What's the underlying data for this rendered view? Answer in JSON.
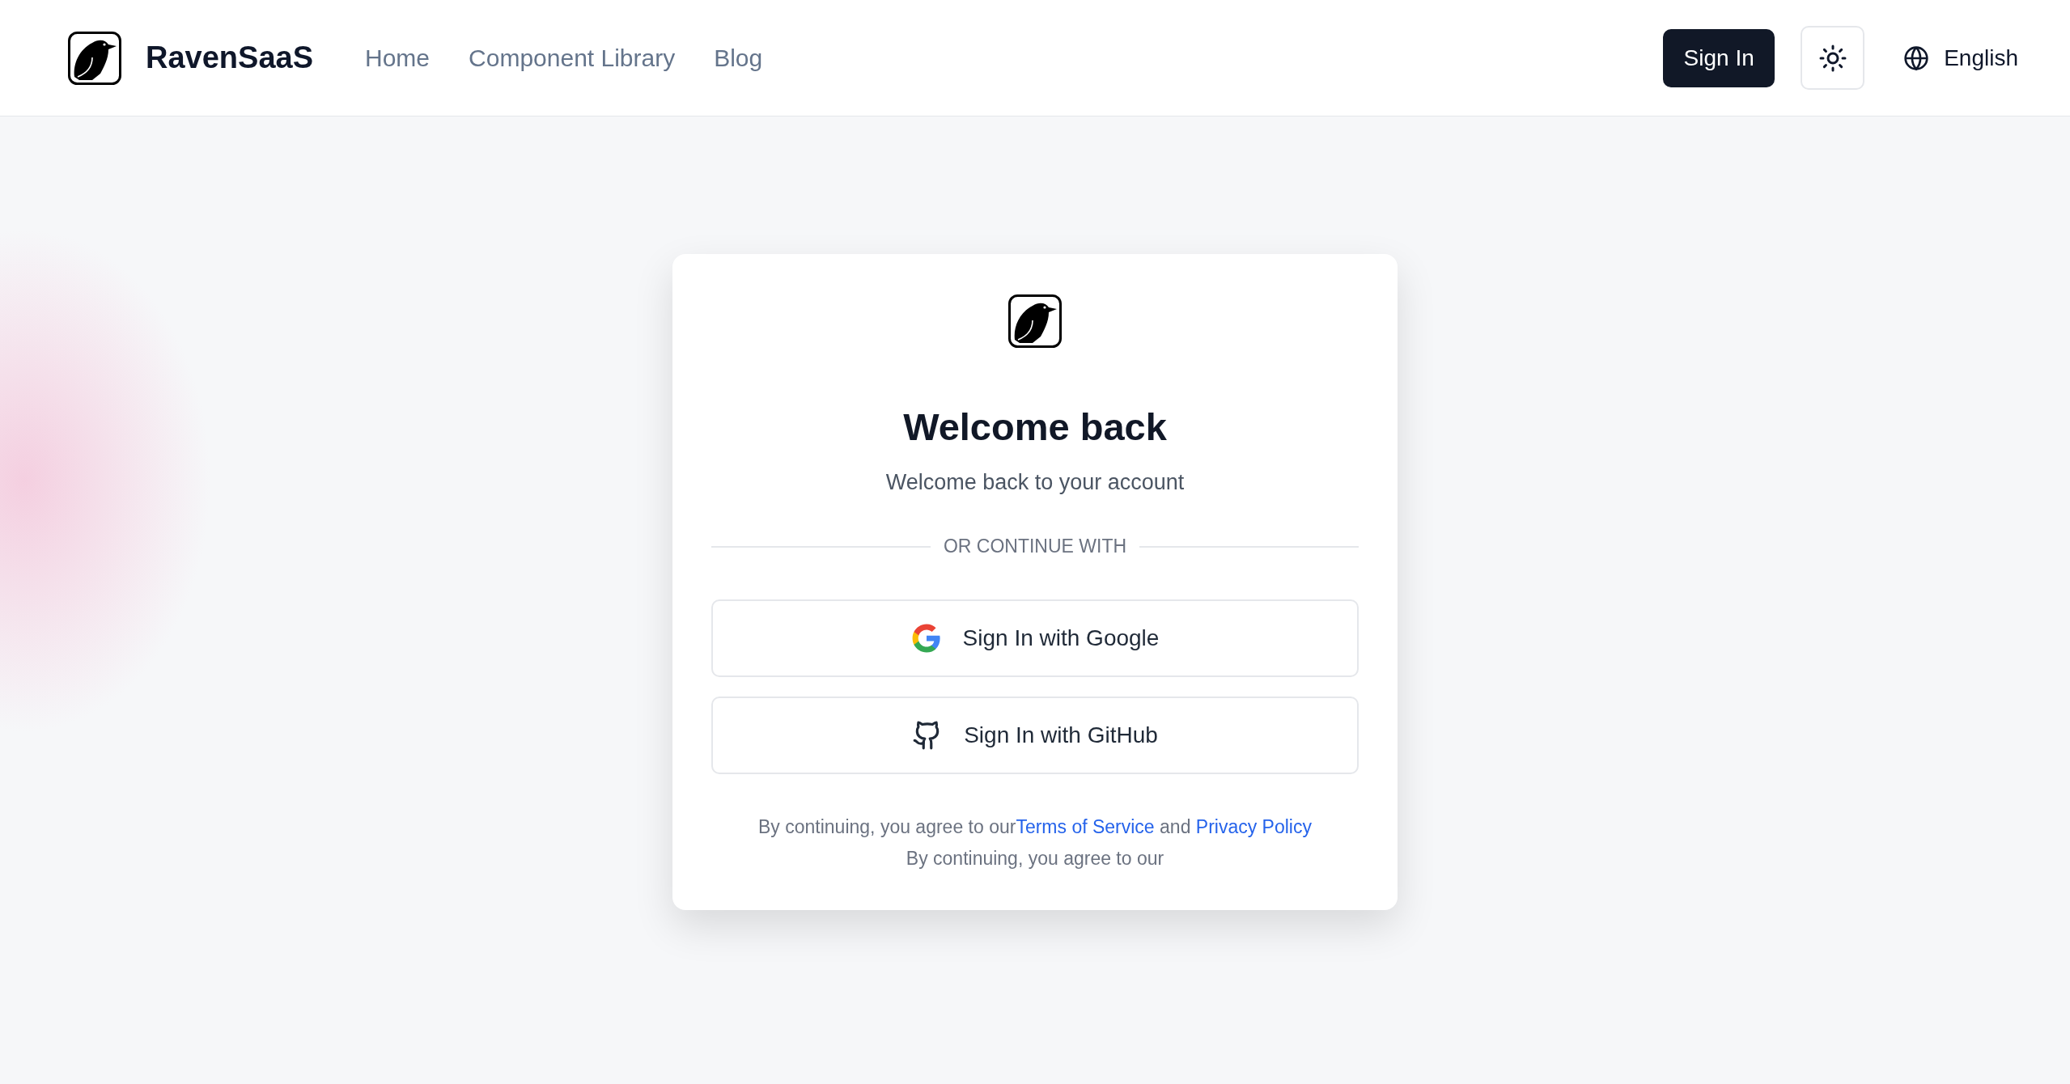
{
  "header": {
    "brand": "RavenSaaS",
    "nav": [
      {
        "label": "Home"
      },
      {
        "label": "Component Library"
      },
      {
        "label": "Blog"
      }
    ],
    "sign_in": "Sign In",
    "language": "English"
  },
  "card": {
    "title": "Welcome back",
    "subtitle": "Welcome back to your account",
    "divider": "OR CONTINUE WITH",
    "providers": [
      {
        "kind": "google",
        "label": "Sign In with Google"
      },
      {
        "kind": "github",
        "label": "Sign In with GitHub"
      }
    ],
    "terms": {
      "lead": "By continuing, you agree to our",
      "terms_link": "Terms of Service",
      "joiner": "and",
      "privacy_link": "Privacy Policy"
    },
    "note": "By continuing, you agree to our"
  }
}
